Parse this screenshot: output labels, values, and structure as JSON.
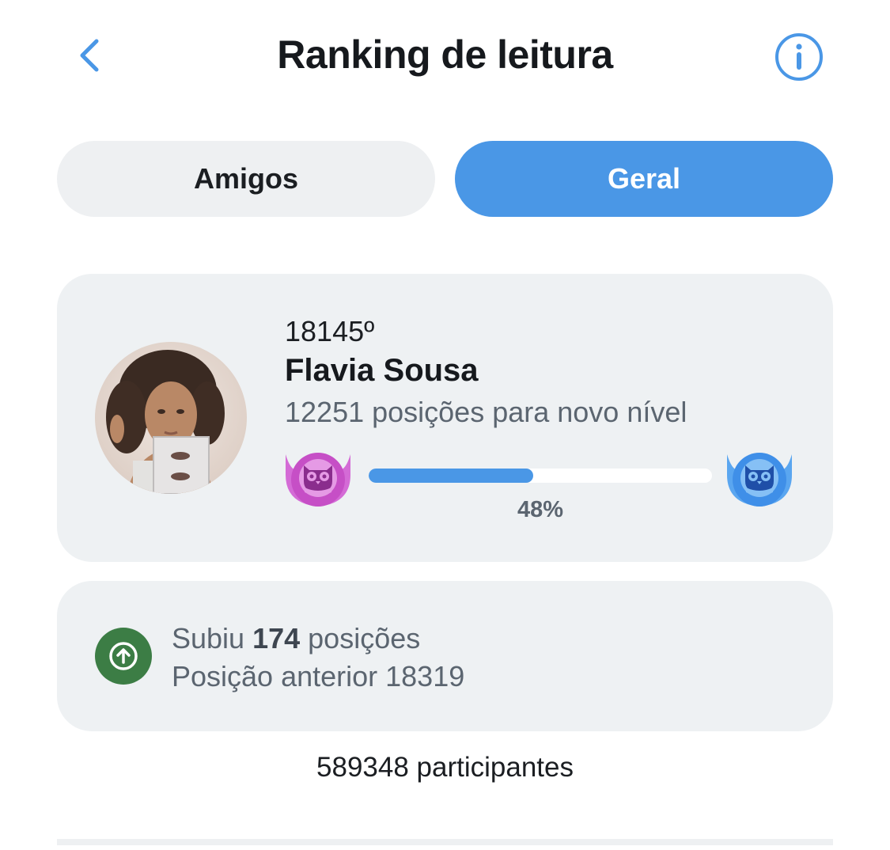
{
  "header": {
    "back_icon": "chevron-left-icon",
    "title": "Ranking de leitura",
    "info_icon": "info-icon"
  },
  "tabs": [
    {
      "label": "Amigos",
      "active": false
    },
    {
      "label": "Geral",
      "active": true
    }
  ],
  "profile": {
    "rank": "18145º",
    "name": "Flavia Sousa",
    "next_level": "12251 posições para novo nível",
    "progress": 0.48,
    "progress_label": "48%",
    "current_badge_icon": "owl-badge-purple-icon",
    "next_badge_icon": "owl-badge-blue-icon"
  },
  "status": {
    "icon": "arrow-up-circle-icon",
    "prefix": "Subiu ",
    "count": "174",
    "suffix": " posições",
    "previous_position": "Posição anterior 18319"
  },
  "participants": "589348 participantes",
  "colors": {
    "accent": "#4a97e6",
    "card_bg": "#eef1f3",
    "success": "#3c7d45",
    "badge_current": "#c64fc6",
    "badge_next": "#3f8fe8"
  }
}
